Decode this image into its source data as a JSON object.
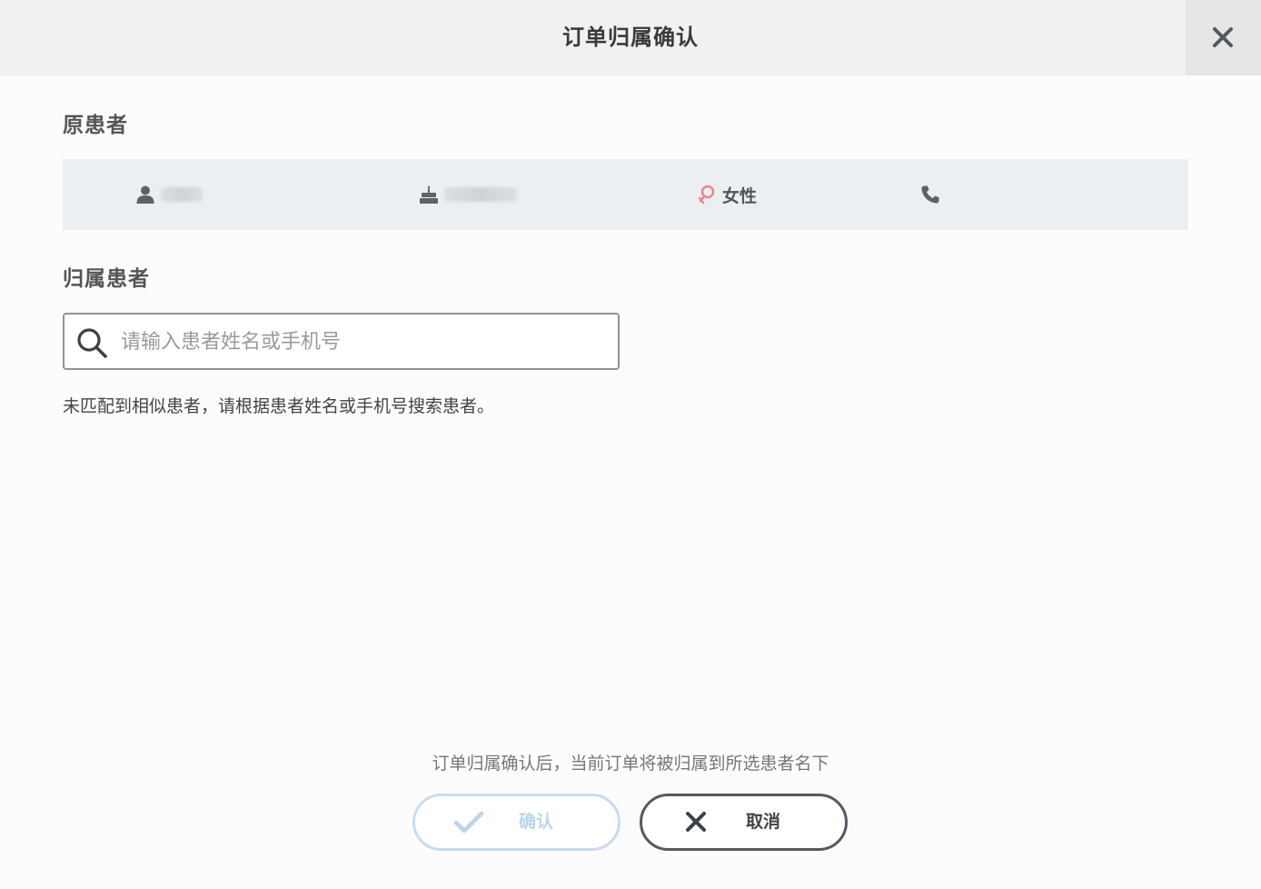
{
  "dialog": {
    "title": "订单归属确认"
  },
  "original_patient": {
    "section_title": "原患者",
    "gender": "女性"
  },
  "assign_patient": {
    "section_title": "归属患者",
    "search_placeholder": "请输入患者姓名或手机号",
    "search_value": "",
    "hint": "未匹配到相似患者，请根据患者姓名或手机号搜索患者。"
  },
  "footer": {
    "note": "订单归属确认后，当前订单将被归属到所选患者名下",
    "confirm_label": "确认",
    "cancel_label": "取消"
  },
  "colors": {
    "header_bg": "#f0f1f2",
    "patient_bar_bg": "#eceff1",
    "female_icon": "#e8898a",
    "confirm_disabled": "#b9d4ee",
    "cancel_border": "#545a5f"
  },
  "icons": {
    "close": "close-icon",
    "person": "person-icon",
    "birthday": "cake-icon",
    "gender": "female-icon",
    "phone": "phone-icon",
    "search": "search-icon",
    "confirm": "check-icon",
    "cancel": "x-icon"
  }
}
